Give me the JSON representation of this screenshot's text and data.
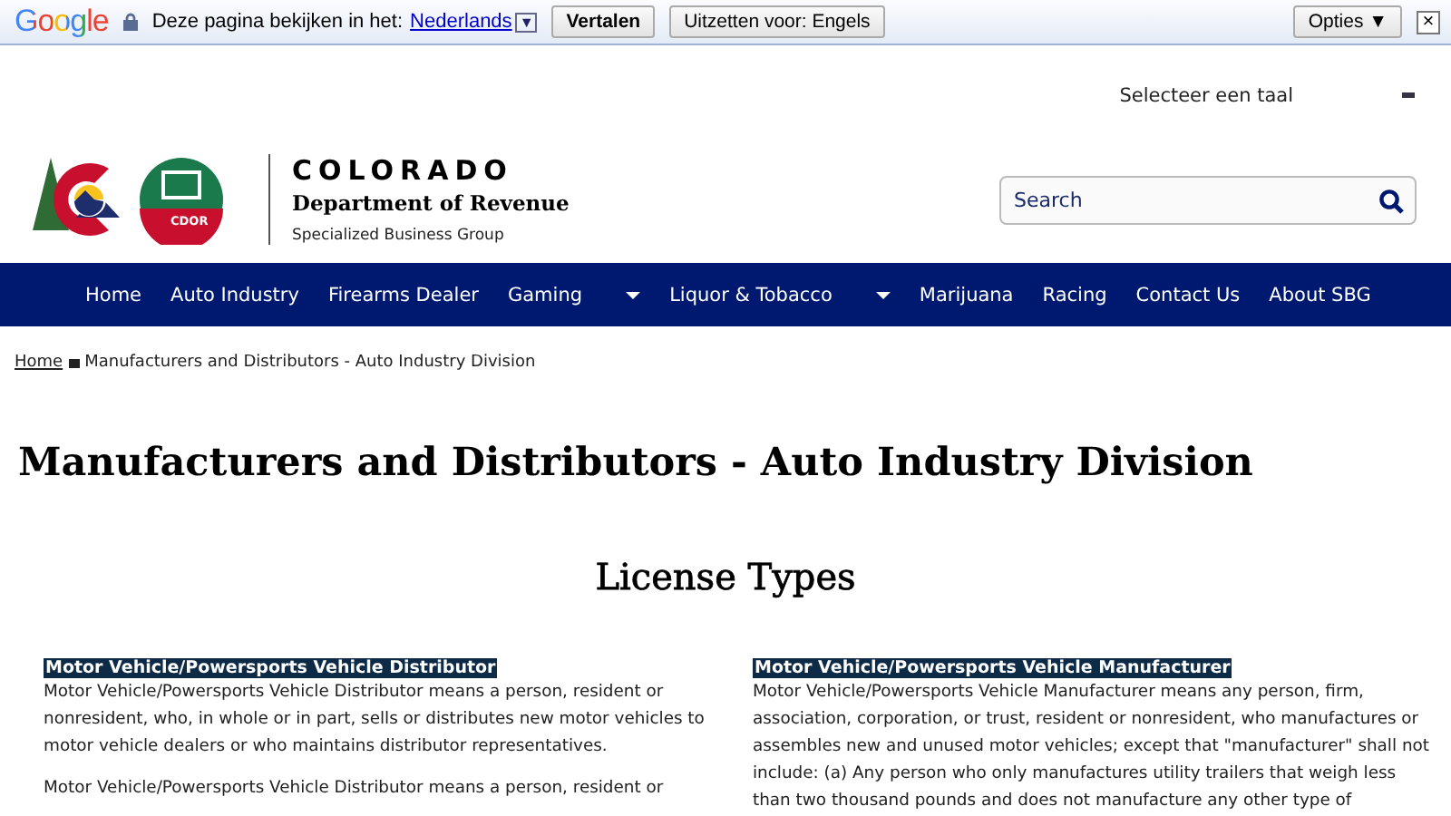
{
  "translate_bar": {
    "logo": "Google",
    "prompt": "Deze pagina bekijken in het:",
    "language": "Nederlands",
    "language_caret": "▼",
    "translate_button": "Vertalen",
    "disable_button": "Uitzetten voor: Engels",
    "options_button": "Opties ▼",
    "close": "×"
  },
  "language_selector": {
    "label": "Selecteer een taal"
  },
  "header": {
    "logo_badge": "CDOR",
    "state": "COLORADO",
    "department": "Department of Revenue",
    "group": "Specialized Business Group",
    "search": {
      "placeholder": "Search"
    }
  },
  "nav": [
    {
      "label": "Home",
      "has_dropdown": false
    },
    {
      "label": "Auto Industry",
      "has_dropdown": false
    },
    {
      "label": "Firearms Dealer",
      "has_dropdown": false
    },
    {
      "label": "Gaming",
      "has_dropdown": true
    },
    {
      "label": "Liquor & Tobacco",
      "has_dropdown": true
    },
    {
      "label": "Marijuana",
      "has_dropdown": false
    },
    {
      "label": "Racing",
      "has_dropdown": false
    },
    {
      "label": "Contact Us",
      "has_dropdown": false
    },
    {
      "label": "About SBG",
      "has_dropdown": false
    }
  ],
  "breadcrumb": {
    "home": "Home",
    "current": "Manufacturers and Distributors - Auto Industry Division"
  },
  "title": "Manufacturers and Distributors - Auto Industry Division",
  "subtitle": "License Types",
  "columns": [
    {
      "heading": "Motor Vehicle/Powersports Vehicle Distributor",
      "paragraphs": [
        "Motor Vehicle/Powersports Vehicle Distributor means a person, resident or nonresident, who, in whole or in part, sells or distributes new motor vehicles to motor vehicle dealers or who maintains distributor representatives.",
        "Motor Vehicle/Powersports Vehicle Distributor means a person, resident or"
      ]
    },
    {
      "heading": "Motor Vehicle/Powersports Vehicle Manufacturer",
      "paragraphs": [
        "Motor Vehicle/Powersports Vehicle Manufacturer means any person, firm, association, corporation, or trust, resident or nonresident, who manufactures or assembles new and unused motor vehicles; except that \"manufacturer\" shall not include: (a) Any person who only manufactures utility trailers that weigh less than two thousand pounds and does not manufacture any other type of"
      ]
    }
  ]
}
